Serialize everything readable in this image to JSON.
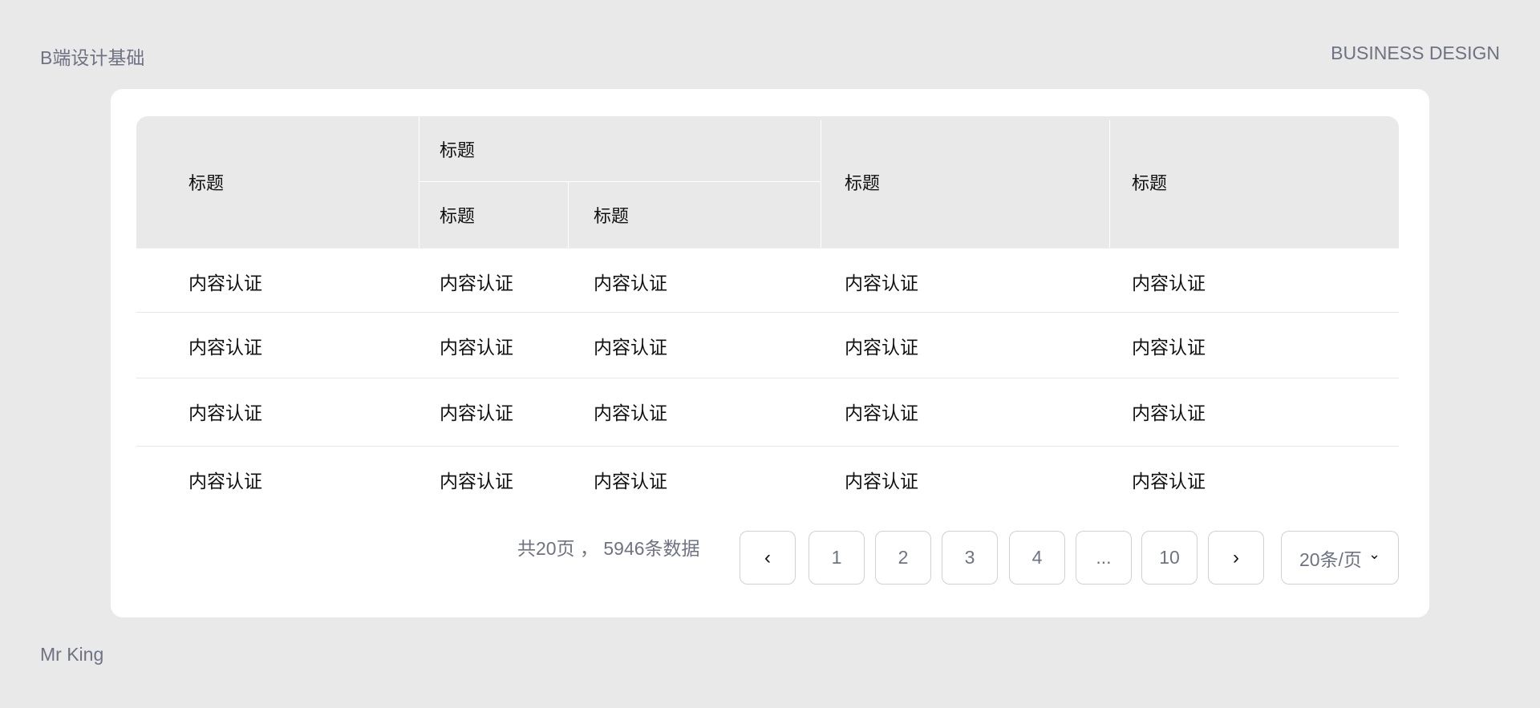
{
  "corners": {
    "top_left": "B端设计基础",
    "top_right": "BUSINESS DESIGN",
    "bottom_left": "Mr King"
  },
  "table": {
    "headers": {
      "col1": "标题",
      "group": "标题",
      "group_sub1": "标题",
      "group_sub2": "标题",
      "col4": "标题",
      "col5": "标题"
    },
    "rows": [
      [
        "内容认证",
        "内容认证",
        "内容认证",
        "内容认证",
        "内容认证"
      ],
      [
        "内容认证",
        "内容认证",
        "内容认证",
        "内容认证",
        "内容认证"
      ],
      [
        "内容认证",
        "内容认证",
        "内容认证",
        "内容认证",
        "内容认证"
      ],
      [
        "内容认证",
        "内容认证",
        "内容认证",
        "内容认证",
        "内容认证"
      ]
    ]
  },
  "pagination": {
    "summary": "共20页 ， 5946条数据",
    "prev": "‹",
    "next": "›",
    "pages": [
      "1",
      "2",
      "3",
      "4",
      "...",
      "10"
    ],
    "page_size": "20条/页",
    "chevron": "⌄"
  }
}
